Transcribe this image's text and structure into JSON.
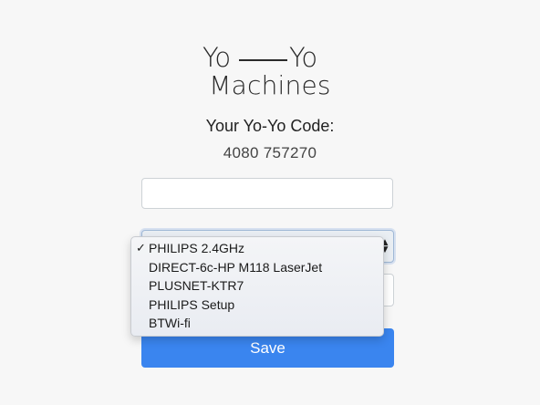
{
  "logo": {
    "yo_left": "Yo",
    "yo_right": "Yo",
    "company": "Machines"
  },
  "code": {
    "label": "Your Yo-Yo Code:",
    "value": "4080 757270"
  },
  "wifi_select": {
    "selected": "PHILIPS 2.4GHz",
    "options": [
      "PHILIPS 2.4GHz",
      "DIRECT-6c-HP M118 LaserJet",
      "PLUSNET-KTR7",
      "PHILIPS Setup",
      "BTWi-fi"
    ],
    "selected_index": 0,
    "check_glyph": "✓"
  },
  "name_input": {
    "value": ""
  },
  "password_input": {
    "value": ""
  },
  "save_button": {
    "label": "Save",
    "color": "#3a85ef"
  }
}
